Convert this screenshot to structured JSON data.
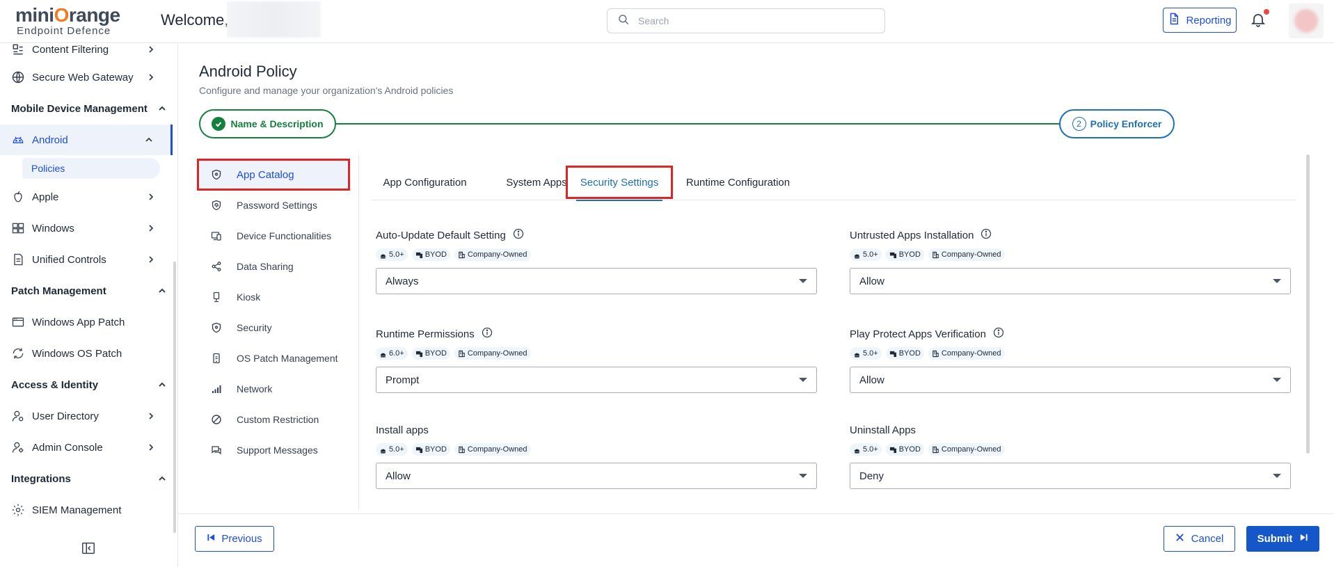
{
  "header": {
    "brand_top": "miniOrange",
    "brand_top_a": "mini",
    "brand_top_o": "O",
    "brand_top_b": "range",
    "brand_bottom": "Endpoint Defence",
    "welcome": "Welcome,",
    "search_placeholder": "Search",
    "reporting_label": "Reporting"
  },
  "sidebar": {
    "items": [
      {
        "label": "Content Filtering",
        "icon": "content-filter-icon"
      },
      {
        "label": "Secure Web Gateway",
        "icon": "globe-icon"
      },
      {
        "label": "Mobile Device Management",
        "section": true
      },
      {
        "label": "Android",
        "icon": "android-icon",
        "active": true
      },
      {
        "label": "Policies"
      },
      {
        "label": "Apple",
        "icon": "apple-icon"
      },
      {
        "label": "Windows",
        "icon": "windows-icon"
      },
      {
        "label": "Unified Controls",
        "icon": "document-icon"
      },
      {
        "label": "Patch Management",
        "section": true
      },
      {
        "label": "Windows App Patch",
        "icon": "window-icon"
      },
      {
        "label": "Windows OS Patch",
        "icon": "refresh-icon"
      },
      {
        "label": "Access & Identity",
        "section": true
      },
      {
        "label": "User Directory",
        "icon": "user-icon"
      },
      {
        "label": "Admin Console",
        "icon": "admin-icon"
      },
      {
        "label": "Integrations",
        "section": true
      },
      {
        "label": "SIEM Management",
        "icon": "gear-icon"
      }
    ]
  },
  "page": {
    "title": "Android Policy",
    "subtitle": "Configure and manage your organization's Android policies"
  },
  "stepper": {
    "step1": "Name & Description",
    "step2_num": "2",
    "step2": "Policy Enforcer"
  },
  "submenu": [
    {
      "label": "App Catalog",
      "icon": "shield-icon",
      "active": true
    },
    {
      "label": "Password Settings",
      "icon": "fingerprint-shield-icon"
    },
    {
      "label": "Device Functionalities",
      "icon": "devices-icon"
    },
    {
      "label": "Data Sharing",
      "icon": "share-icon"
    },
    {
      "label": "Kiosk",
      "icon": "kiosk-icon"
    },
    {
      "label": "Security",
      "icon": "shield-icon"
    },
    {
      "label": "OS Patch Management",
      "icon": "phone-patch-icon"
    },
    {
      "label": "Network",
      "icon": "signal-icon"
    },
    {
      "label": "Custom Restriction",
      "icon": "block-icon"
    },
    {
      "label": "Support Messages",
      "icon": "message-icon"
    }
  ],
  "tabs": [
    {
      "label": "App Configuration"
    },
    {
      "label": "System Apps"
    },
    {
      "label": "Security Settings",
      "active": true
    },
    {
      "label": "Runtime Configuration"
    }
  ],
  "settings": [
    {
      "title": "Auto-Update Default Setting",
      "info": true,
      "version": "5.0+",
      "byod": "BYOD",
      "owned": "Company-Owned",
      "value": "Always"
    },
    {
      "title": "Untrusted Apps Installation",
      "info": true,
      "version": "5.0+",
      "byod": "BYOD",
      "owned": "Company-Owned",
      "value": "Allow"
    },
    {
      "title": "Runtime Permissions",
      "info": true,
      "version": "6.0+",
      "byod": "BYOD",
      "owned": "Company-Owned",
      "value": "Prompt"
    },
    {
      "title": "Play Protect Apps Verification",
      "info": true,
      "version": "5.0+",
      "byod": "BYOD",
      "owned": "Company-Owned",
      "value": "Allow"
    },
    {
      "title": "Install apps",
      "info": false,
      "version": "5.0+",
      "byod": "BYOD",
      "owned": "Company-Owned",
      "value": "Allow"
    },
    {
      "title": "Uninstall Apps",
      "info": false,
      "version": "5.0+",
      "byod": "BYOD",
      "owned": "Company-Owned",
      "value": "Deny"
    }
  ],
  "footer": {
    "previous": "Previous",
    "cancel": "Cancel",
    "submit": "Submit"
  },
  "colors": {
    "accent": "#1d4ed8",
    "success": "#15803d",
    "highlight": "#dc2626",
    "brand_orange": "#f47c20"
  }
}
